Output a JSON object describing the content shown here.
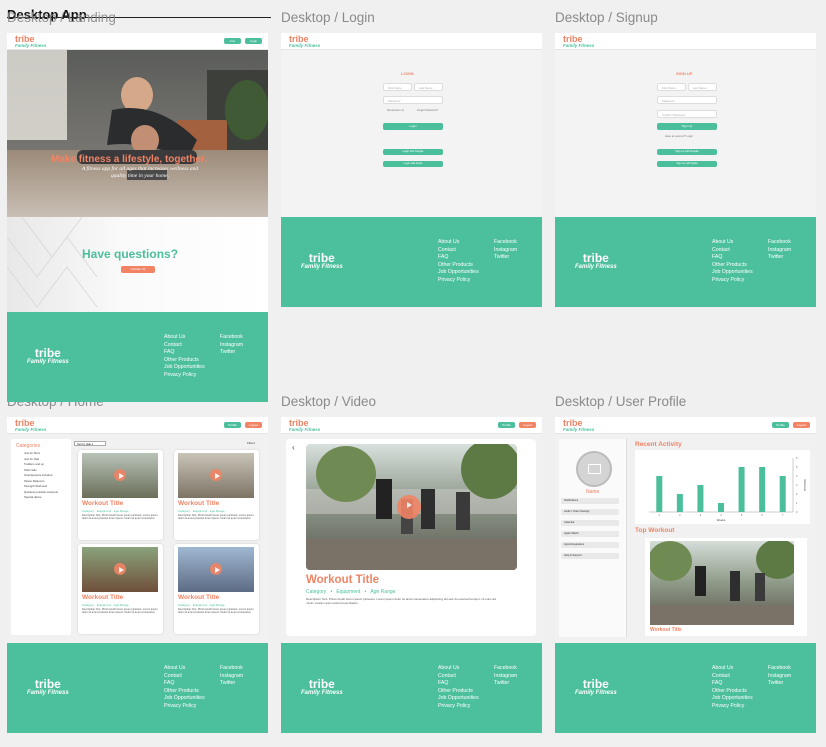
{
  "page": {
    "title": "Desktop App"
  },
  "frames": {
    "landing": "Desktop / Landing",
    "login": "Desktop / Login",
    "signup": "Desktop / Signup",
    "home": "Desktop / Home",
    "video": "Desktop / Video",
    "profile": "Desktop / User Profile"
  },
  "brand": {
    "name": "tribe",
    "tagline": "Family Fitness"
  },
  "colors": {
    "teal": "#4bbf9c",
    "coral": "#f08465"
  },
  "nav": {
    "join": "Join",
    "login": "Login",
    "profile": "Profile",
    "logout": "Logout"
  },
  "landing": {
    "hero_title": "Make fitness a lifestyle, together.",
    "hero_sub": "A fitness app for all ages that increases wellness and quality time in your home.",
    "questions": "Have questions?",
    "contact": "Contact Us"
  },
  "footer": {
    "col1": [
      "About Us",
      "Contact",
      "FAQ",
      "Other Products",
      "Job Opportunities",
      "Privacy Policy"
    ],
    "col2": [
      "Facebook",
      "Instagram",
      "Twitter"
    ]
  },
  "login": {
    "heading": "LOGIN",
    "first": "First Name",
    "last": "Last Name",
    "password": "Password",
    "remember": "Remember me",
    "forgot": "Forgot Password?",
    "submit": "Login",
    "google": "Login with Google",
    "apple": "Login with Apple"
  },
  "signup": {
    "heading": "SIGN UP",
    "first": "First Name",
    "last": "Last Name",
    "password": "Password",
    "confirm": "Confirm Password",
    "submit": "Sign Up",
    "have": "Have an account? Login",
    "google": "Sign up with Google",
    "apple": "Sign up with Apple"
  },
  "home": {
    "categories_title": "Categories",
    "categories": [
      "Just for Mom",
      "Just for Dad",
      "Toddlers and up",
      "Older kids",
      "Grandparents included",
      "Stress Relievers",
      "Strength Workouts",
      "Quickest possible workouts",
      "Special dance"
    ],
    "sort": "Sort by date",
    "filter": "Filters",
    "card_title": "Workout Title",
    "category": "Category",
    "equipment": "Equipment",
    "age": "Age Range",
    "desc": "Description Text. Photo booth lorem ipsum pinterest. Lorem ipsum dolor sit amet pinterest lorem ipsum. Dolor sit amet consectetur."
  },
  "video": {
    "title": "Workout Title",
    "category": "Category",
    "equipment": "Equipment",
    "age": "Age Range",
    "desc": "Description Text. Photo booth lorem ipsum pinterest. Lorem ipsum dolor sit amet consectetur adipiscing elit sed do eiusmod tempor. Ut enim ad minim veniam quis nostrud exercitation."
  },
  "profile": {
    "name": "Name",
    "menu": [
      "Notifications",
      "Audio / Video Settings",
      "Calendar",
      "Apple Watch",
      "Apps/Integrations",
      "Help & Support"
    ],
    "recent": "Recent Activity",
    "top": "Top Workout",
    "top_title": "Workout Title",
    "xlabel": "Weeks",
    "ylabel": "Workouts"
  },
  "chart_data": {
    "type": "bar",
    "categories": [
      "1",
      "2",
      "3",
      "4",
      "5",
      "6",
      "7"
    ],
    "values": [
      4,
      2,
      3,
      1,
      5,
      5,
      4
    ],
    "xlabel": "Weeks",
    "ylabel": "Workouts",
    "ylim": [
      0,
      6
    ]
  }
}
